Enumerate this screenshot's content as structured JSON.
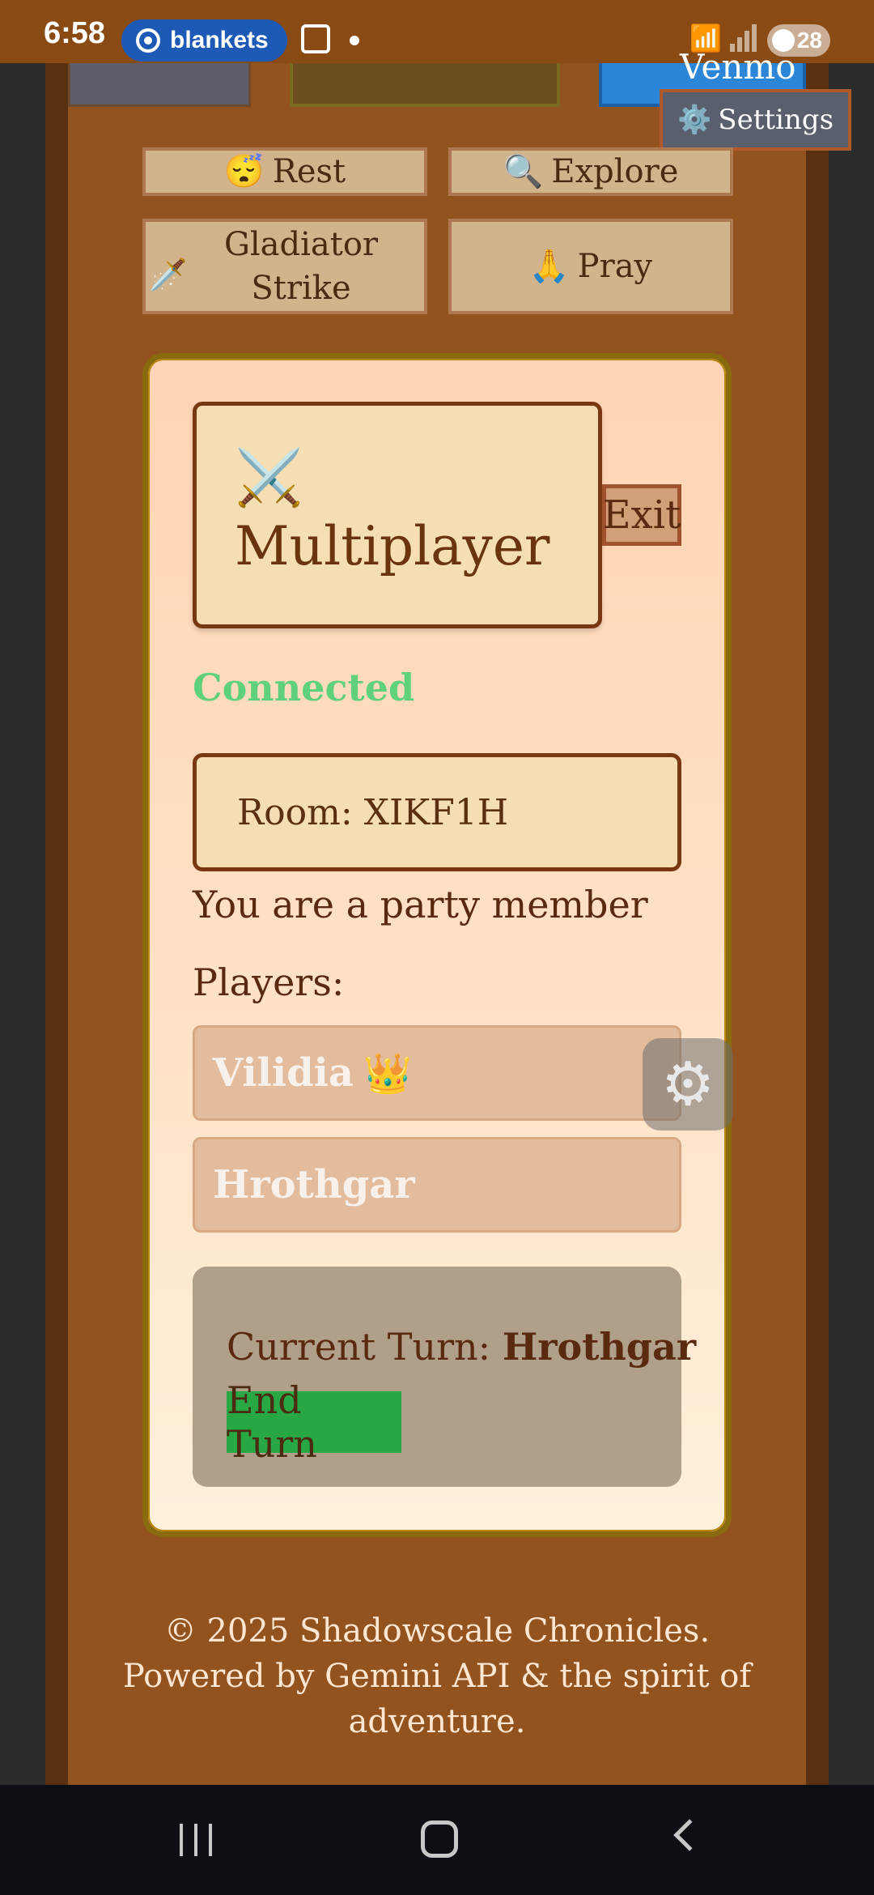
{
  "status_bar": {
    "time": "6:58",
    "notification_pill": "blankets",
    "battery": "28"
  },
  "top_tiles": {
    "venmo_label": "Venmo"
  },
  "settings_button": {
    "icon": "gear-icon",
    "label": "Settings",
    "glyph": "⚙️"
  },
  "actions": [
    {
      "label": "Rest",
      "icon": "😴"
    },
    {
      "label": "Explore",
      "icon": "🔍"
    },
    {
      "label": "Gladiator Strike",
      "icon": "🗡️"
    },
    {
      "label": "Pray",
      "icon": "🙏"
    }
  ],
  "multiplayer": {
    "icon": "⚔️",
    "title": "Multiplayer",
    "exit_label": "Exit",
    "connection_status": "Connected",
    "room_label": "Room: XIKF1H",
    "role_text": "You are a party member",
    "players_label": "Players:",
    "players": [
      {
        "name": "Vilidia",
        "badge": "👑"
      },
      {
        "name": "Hrothgar",
        "badge": ""
      }
    ],
    "current_turn_label": "Current Turn:",
    "current_turn_player": "Hrothgar",
    "end_turn_label": "End Turn"
  },
  "floating_button": {
    "icon": "gear-tools-icon",
    "glyph": "⚙"
  },
  "footer": {
    "line1": "© 2025 Shadowscale Chronicles.",
    "line2": "Powered by Gemini API & the spirit of",
    "line3": "adventure."
  },
  "colors": {
    "connected": "#5ed17a",
    "end_turn_bg": "#28a745",
    "frame_brown": "#93531f"
  }
}
